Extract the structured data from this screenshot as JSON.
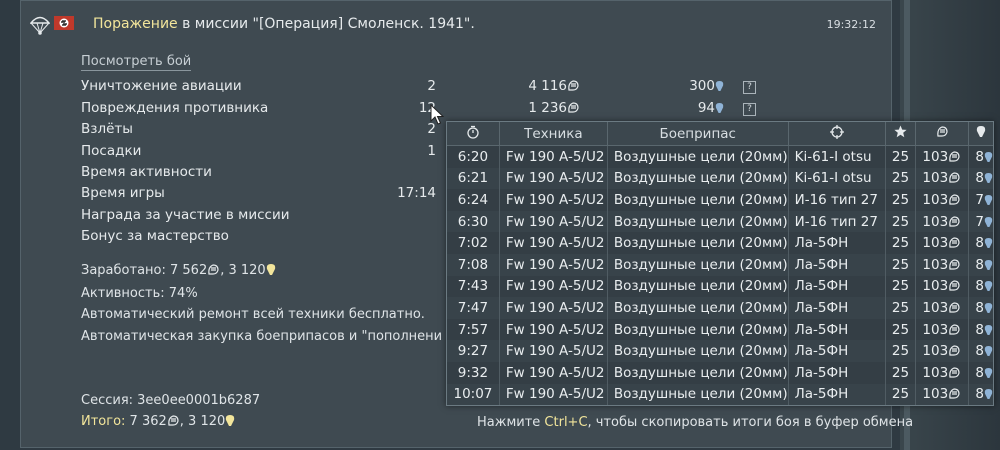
{
  "header": {
    "defeat_word": "Поражение",
    "title_rest": " в миссии \"[Операция] Смоленск. 1941\".",
    "time": "19:32:12"
  },
  "view_battle_link": "Посмотреть бой",
  "stats": [
    {
      "label": "Уничтожение авиации",
      "count": "2",
      "lions": "4 116",
      "rp": "300"
    },
    {
      "label": "Повреждения противника",
      "count": "12",
      "lions": "1 236",
      "rp": "94"
    },
    {
      "label": "Взлёты",
      "count": "2"
    },
    {
      "label": "Посадки",
      "count": "1"
    },
    {
      "label": "Время активности"
    },
    {
      "label": "Время игры",
      "count": "17:14"
    },
    {
      "label": "Награда за участие в миссии"
    },
    {
      "label": "Бонус за мастерство"
    }
  ],
  "earned": {
    "label": "Заработано: 7 562",
    "sep": ", 3 120"
  },
  "activity": "Активность: 74%",
  "auto_repair": "Автоматический ремонт всей техники бесплатно.",
  "auto_purchase": "Автоматическая закупка боеприпасов и \"пополнения эк",
  "session": "Сессия: 3ee0ee0001b6287",
  "total": {
    "label": "Итого:",
    "value": " 7 362",
    "rp": ", 3 120"
  },
  "copy_hint": {
    "pre": "Нажмите ",
    "key": "Ctrl+C",
    "post": ", чтобы скопировать итоги боя в буфер обмена"
  },
  "popup": {
    "columns": [
      "Техника",
      "Боеприпас",
      "",
      "",
      ""
    ],
    "rows": [
      [
        "6:20",
        "Fw 190 A-5/U2",
        "Воздушные цели (20мм)",
        "Ki-61-I otsu",
        "25",
        "103",
        "8"
      ],
      [
        "6:21",
        "Fw 190 A-5/U2",
        "Воздушные цели (20мм)",
        "Ki-61-I otsu",
        "25",
        "103",
        "8"
      ],
      [
        "6:24",
        "Fw 190 A-5/U2",
        "Воздушные цели (20мм)",
        "И-16 тип 27",
        "25",
        "103",
        "7"
      ],
      [
        "6:30",
        "Fw 190 A-5/U2",
        "Воздушные цели (20мм)",
        "И-16 тип 27",
        "25",
        "103",
        "7"
      ],
      [
        "7:02",
        "Fw 190 A-5/U2",
        "Воздушные цели (20мм)",
        "Ла-5ФН",
        "25",
        "103",
        "8"
      ],
      [
        "7:08",
        "Fw 190 A-5/U2",
        "Воздушные цели (20мм)",
        "Ла-5ФН",
        "25",
        "103",
        "8"
      ],
      [
        "7:43",
        "Fw 190 A-5/U2",
        "Воздушные цели (20мм)",
        "Ла-5ФН",
        "25",
        "103",
        "8"
      ],
      [
        "7:47",
        "Fw 190 A-5/U2",
        "Воздушные цели (20мм)",
        "Ла-5ФН",
        "25",
        "103",
        "8"
      ],
      [
        "7:57",
        "Fw 190 A-5/U2",
        "Воздушные цели (20мм)",
        "Ла-5ФН",
        "25",
        "103",
        "8"
      ],
      [
        "9:27",
        "Fw 190 A-5/U2",
        "Воздушные цели (20мм)",
        "Ла-5ФН",
        "25",
        "103",
        "8"
      ],
      [
        "9:32",
        "Fw 190 A-5/U2",
        "Воздушные цели (20мм)",
        "Ла-5ФН",
        "25",
        "103",
        "8"
      ],
      [
        "10:07",
        "Fw 190 A-5/U2",
        "Воздушные цели (20мм)",
        "Ла-5ФН",
        "25",
        "103",
        "8"
      ]
    ]
  },
  "colors": {
    "accent_yellow": "#f2e59b",
    "rp_blue": "#8fb3d6",
    "bg": "#3f4a51"
  },
  "icons": [
    "parachute-icon",
    "german-flag-icon",
    "lion-icon",
    "research-point-icon",
    "question-icon",
    "clock-icon",
    "target-icon",
    "star-icon",
    "mouse-cursor-icon"
  ]
}
